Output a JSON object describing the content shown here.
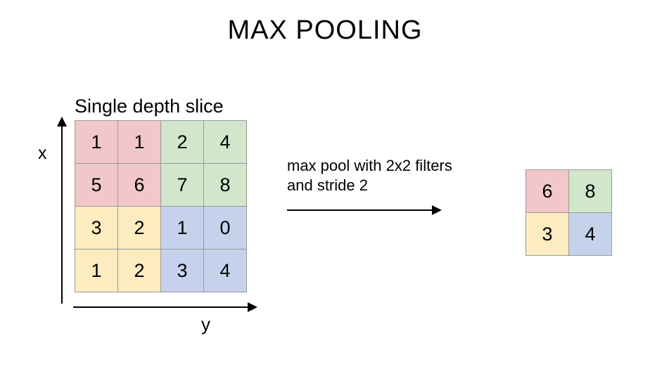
{
  "title": "MAX POOLING",
  "subtitle": "Single depth slice",
  "axis": {
    "x": "x",
    "y": "y"
  },
  "operation": {
    "line1": "max pool with 2x2 filters",
    "line2": "and stride 2"
  },
  "input_grid": {
    "rows": [
      [
        1,
        1,
        2,
        4
      ],
      [
        5,
        6,
        7,
        8
      ],
      [
        3,
        2,
        1,
        0
      ],
      [
        1,
        2,
        3,
        4
      ]
    ],
    "region_colors": [
      [
        "pink",
        "pink",
        "green",
        "green"
      ],
      [
        "pink",
        "pink",
        "green",
        "green"
      ],
      [
        "yellow",
        "yellow",
        "blue",
        "blue"
      ],
      [
        "yellow",
        "yellow",
        "blue",
        "blue"
      ]
    ]
  },
  "output_grid": {
    "rows": [
      [
        6,
        8
      ],
      [
        3,
        4
      ]
    ],
    "region_colors": [
      [
        "pink",
        "green"
      ],
      [
        "yellow",
        "blue"
      ]
    ]
  }
}
